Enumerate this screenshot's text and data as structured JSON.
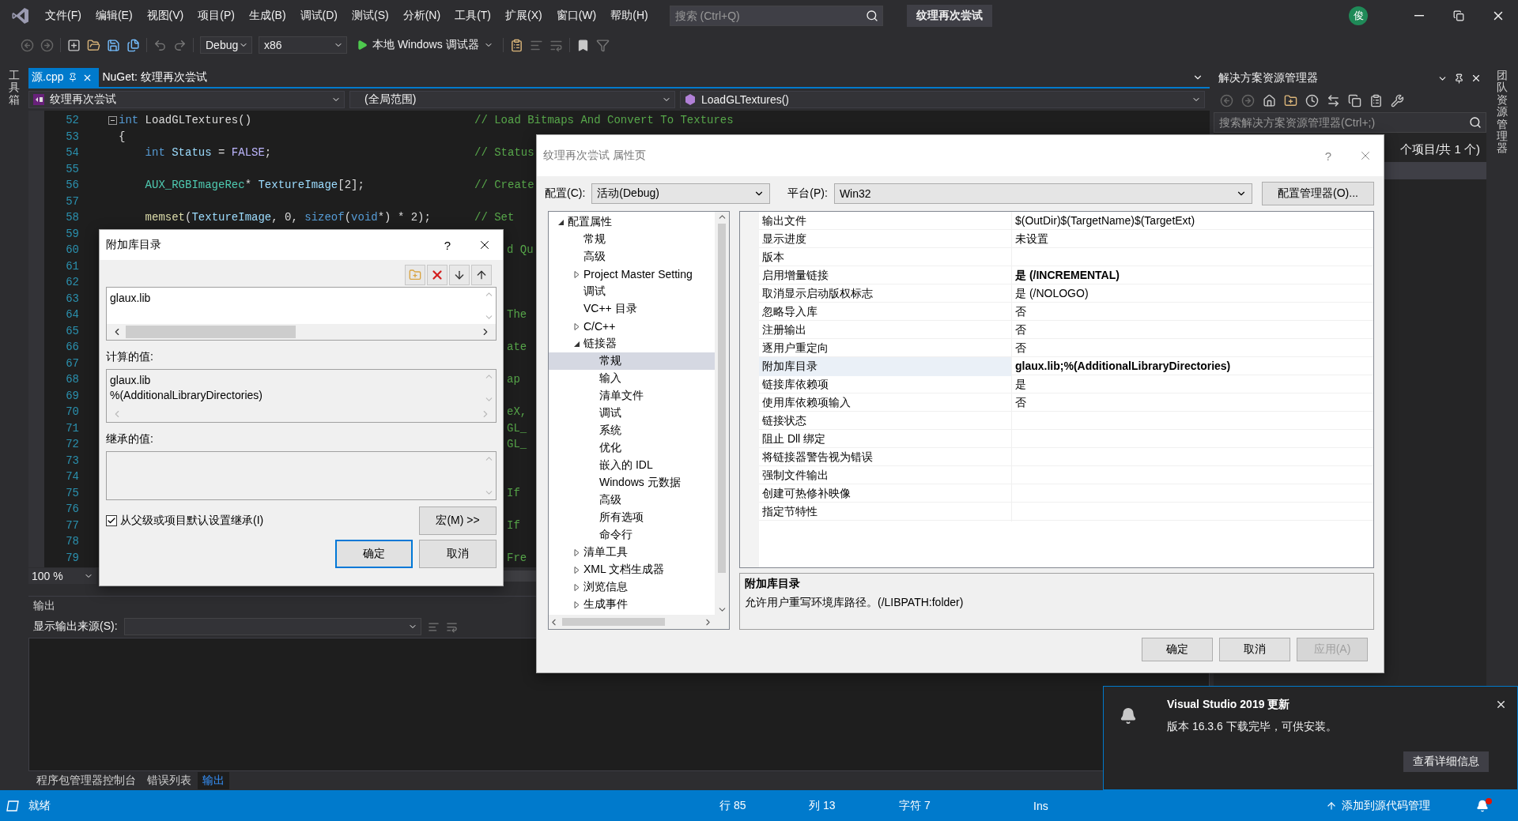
{
  "menu_bar": {
    "items": [
      "文件(F)",
      "编辑(E)",
      "视图(V)",
      "项目(P)",
      "生成(B)",
      "调试(D)",
      "测试(S)",
      "分析(N)",
      "工具(T)",
      "扩展(X)",
      "窗口(W)",
      "帮助(H)"
    ],
    "search": {
      "placeholder": "搜索 (Ctrl+Q)"
    },
    "title": "纹理再次尝试",
    "avatar": "俊"
  },
  "toolbar": {
    "configuration": "Debug",
    "platform": "x86",
    "debugger": "本地 Windows 调试器"
  },
  "side_strips": {
    "left": "工具箱",
    "right": "团队资源管理器"
  },
  "editor": {
    "tabs": [
      {
        "label": "源.cpp",
        "selected": true
      },
      {
        "label": "NuGet: 纹理再次尝试",
        "selected": false
      }
    ],
    "nav": {
      "project": "纹理再次尝试",
      "scope": "(全局范围)",
      "member": "LoadGLTextures()"
    },
    "lines": [
      {
        "number": "52",
        "kind": "fold_start",
        "tokens": [
          {
            "text": "int",
            "kind": "keyword"
          },
          {
            "text": " LoadGLTextures()",
            "kind": "plain"
          }
        ],
        "comment": "// Load Bitmaps And Convert To Textures",
        "children": [
          {
            "number": "53",
            "kind": "brace",
            "tokens": [
              {
                "text": "{",
                "kind": "plain"
              }
            ]
          },
          {
            "number": "54",
            "kind": "code",
            "tokens": [
              {
                "text": "int",
                "kind": "keyword"
              },
              {
                "text": " Status",
                "kind": "variable"
              },
              {
                "text": " = ",
                "kind": "plain"
              },
              {
                "text": "FALSE",
                "kind": "macro"
              },
              {
                "text": ";",
                "kind": "plain"
              }
            ],
            "comment": "// Status"
          },
          {
            "number": "55",
            "kind": "blank"
          },
          {
            "number": "56",
            "kind": "code",
            "tokens": [
              {
                "text": "AUX_RGBImageRec",
                "kind": "type"
              },
              {
                "text": "* ",
                "kind": "plain"
              },
              {
                "text": "TextureImage",
                "kind": "variable"
              },
              {
                "text": "[2];",
                "kind": "plain"
              }
            ],
            "comment": "// Create"
          },
          {
            "number": "57",
            "kind": "blank"
          },
          {
            "number": "58",
            "kind": "code",
            "tokens": [
              {
                "text": "memset",
                "kind": "function"
              },
              {
                "text": "(",
                "kind": "plain"
              },
              {
                "text": "TextureImage",
                "kind": "variable"
              },
              {
                "text": ", 0, ",
                "kind": "plain"
              },
              {
                "text": "sizeof",
                "kind": "keyword"
              },
              {
                "text": "(",
                "kind": "plain"
              },
              {
                "text": "void",
                "kind": "keyword"
              },
              {
                "text": "*) * 2);",
                "kind": "plain"
              }
            ],
            "comment": "// Set"
          }
        ]
      },
      {
        "number": "59",
        "kind": "tail"
      },
      {
        "number": "60",
        "kind": "tail",
        "tail": "d Qu"
      },
      {
        "number": "61",
        "kind": "tail"
      },
      {
        "number": "62",
        "kind": "tail"
      },
      {
        "number": "63",
        "kind": "tail"
      },
      {
        "number": "64",
        "kind": "tail",
        "tail": "The"
      },
      {
        "number": "65",
        "kind": "tail"
      },
      {
        "number": "66",
        "kind": "tail",
        "tail": "ate"
      },
      {
        "number": "67",
        "kind": "tail"
      },
      {
        "number": "68",
        "kind": "tail",
        "tail": "ap"
      },
      {
        "number": "69",
        "kind": "tail"
      },
      {
        "number": "70",
        "kind": "tail",
        "tail": "eX,"
      },
      {
        "number": "71",
        "kind": "tail",
        "tail": "GL_"
      },
      {
        "number": "72",
        "kind": "tail",
        "tail": "GL_"
      },
      {
        "number": "73",
        "kind": "tail"
      },
      {
        "number": "74",
        "kind": "tail"
      },
      {
        "number": "75",
        "kind": "tail",
        "tail": "If"
      },
      {
        "number": "76",
        "kind": "tail"
      },
      {
        "number": "77",
        "kind": "tail",
        "tail": "If"
      },
      {
        "number": "78",
        "kind": "tail"
      },
      {
        "number": "79",
        "kind": "tail",
        "tail": "Fre"
      }
    ],
    "zoom": "100 %"
  },
  "output": {
    "title": "输出",
    "source_label": "显示输出来源(S):"
  },
  "bottom_tabs": [
    {
      "label": "程序包管理器控制台",
      "selected": false
    },
    {
      "label": "错误列表",
      "selected": false
    },
    {
      "label": "输出",
      "selected": true
    }
  ],
  "solution_explorer": {
    "title": "解决方案资源管理器",
    "search": {
      "placeholder": "搜索解决方案资源管理器(Ctrl+;)"
    },
    "row": "个项目/共 1 个)"
  },
  "library_dialog": {
    "title": "附加库目录",
    "help": "?",
    "entries": [
      "glaux.lib"
    ],
    "computed_label": "计算的值:",
    "computed": [
      "glaux.lib",
      "%(AdditionalLibraryDirectories)"
    ],
    "inherited_label": "继承的值:",
    "inherit": {
      "label": "从父级或项目默认设置继承(I)",
      "checked": true
    },
    "macros": "宏(M) >>",
    "buttons": [
      {
        "label": "确定",
        "default": true
      },
      {
        "label": "取消",
        "default": false
      }
    ]
  },
  "property_dialog": {
    "title": "纹理再次尝试 属性页",
    "help": "?",
    "config_label": "配置(C):",
    "config": "活动(Debug)",
    "platform_label": "平台(P):",
    "platform": "Win32",
    "manager": "配置管理器(O)...",
    "tree": [
      {
        "label": "配置属性",
        "expanded": true,
        "selected": false,
        "children": [
          {
            "label": "常规",
            "selected": false
          },
          {
            "label": "高级",
            "selected": false
          },
          {
            "label": "Project Master Setting",
            "expanded": false,
            "selected": false
          },
          {
            "label": "调试",
            "selected": false
          },
          {
            "label": "VC++ 目录",
            "selected": false
          },
          {
            "label": "C/C++",
            "expanded": false,
            "selected": false
          },
          {
            "label": "链接器",
            "expanded": true,
            "selected": false,
            "children": [
              {
                "label": "常规",
                "selected": true
              },
              {
                "label": "输入",
                "selected": false
              },
              {
                "label": "清单文件",
                "selected": false
              },
              {
                "label": "调试",
                "selected": false
              },
              {
                "label": "系统",
                "selected": false
              },
              {
                "label": "优化",
                "selected": false
              },
              {
                "label": "嵌入的 IDL",
                "selected": false
              },
              {
                "label": "Windows 元数据",
                "selected": false
              },
              {
                "label": "高级",
                "selected": false
              },
              {
                "label": "所有选项",
                "selected": false
              },
              {
                "label": "命令行",
                "selected": false
              }
            ]
          },
          {
            "label": "清单工具",
            "expanded": false,
            "selected": false
          },
          {
            "label": "XML 文档生成器",
            "expanded": false,
            "selected": false
          },
          {
            "label": "浏览信息",
            "expanded": false,
            "selected": false
          },
          {
            "label": "生成事件",
            "expanded": false,
            "selected": false
          }
        ]
      }
    ],
    "properties": [
      {
        "name": "输出文件",
        "value": "$(OutDir)$(TargetName)$(TargetExt)",
        "bold": false,
        "selected": false
      },
      {
        "name": "显示进度",
        "value": "未设置",
        "bold": false,
        "selected": false
      },
      {
        "name": "版本",
        "selected": false
      },
      {
        "name": "启用增量链接",
        "value": "是 (/INCREMENTAL)",
        "bold": true,
        "selected": false
      },
      {
        "name": "取消显示启动版权标志",
        "value": "是 (/NOLOGO)",
        "bold": false,
        "selected": false
      },
      {
        "name": "忽略导入库",
        "value": "否",
        "bold": false,
        "selected": false
      },
      {
        "name": "注册输出",
        "value": "否",
        "bold": false,
        "selected": false
      },
      {
        "name": "逐用户重定向",
        "value": "否",
        "bold": false,
        "selected": false
      },
      {
        "name": "附加库目录",
        "value": "glaux.lib;%(AdditionalLibraryDirectories)",
        "bold": true,
        "selected": true
      },
      {
        "name": "链接库依赖项",
        "value": "是",
        "bold": false,
        "selected": false
      },
      {
        "name": "使用库依赖项输入",
        "value": "否",
        "bold": false,
        "selected": false
      },
      {
        "name": "链接状态",
        "selected": false
      },
      {
        "name": "阻止 Dll 绑定",
        "selected": false
      },
      {
        "name": "将链接器警告视为错误",
        "selected": false
      },
      {
        "name": "强制文件输出",
        "selected": false
      },
      {
        "name": "创建可热修补映像",
        "selected": false
      },
      {
        "name": "指定节特性",
        "selected": false
      }
    ],
    "description": {
      "title": "附加库目录",
      "text": "允许用户重写环境库路径。(/LIBPATH:folder)"
    },
    "buttons": [
      {
        "label": "确定",
        "disabled": false
      },
      {
        "label": "取消",
        "disabled": false
      },
      {
        "label": "应用(A)",
        "disabled": true
      }
    ]
  },
  "notification": {
    "title": "Visual Studio 2019 更新",
    "text": "版本 16.3.6 下载完毕，可供安装。",
    "action": "查看详细信息"
  },
  "status_bar": {
    "status": "就绪",
    "line": "行 85",
    "column": "列 13",
    "char": "字符 7",
    "mode": "Ins",
    "source_control": "添加到源代码管理"
  }
}
